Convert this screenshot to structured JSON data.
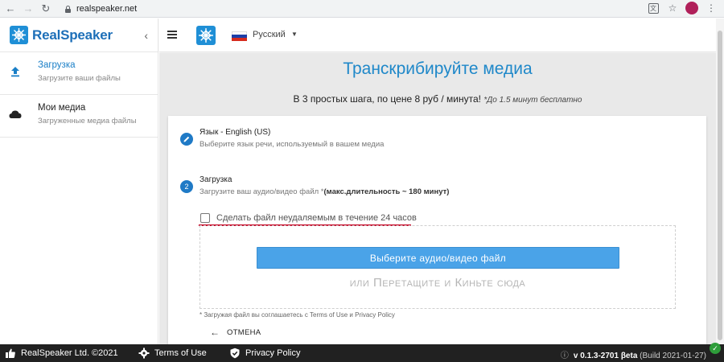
{
  "browser": {
    "url": "realspeaker.net",
    "back_icon": "back-arrow-icon",
    "forward_icon": "forward-arrow-icon",
    "reload_icon": "reload-icon"
  },
  "sidebar": {
    "brand": "RealSpeaker",
    "collapse_icon": "chevron-left-icon",
    "items": [
      {
        "title": "Загрузка",
        "subtitle": "Загрузите ваши файлы",
        "icon": "upload-icon",
        "active": true
      },
      {
        "title": "Мои медиа",
        "subtitle": "Загруженные медиа файлы",
        "icon": "cloud-icon",
        "active": false
      }
    ]
  },
  "topbar": {
    "language": "Русский",
    "flag_colors": [
      "#ffffff",
      "#1c3fa8",
      "#d52b1e"
    ]
  },
  "main": {
    "headline": "Транскрибируйте медиа",
    "subline": "В 3 простых шага, по цене 8 руб / минута!",
    "subline_note": "*До 1.5 минут бесплатно",
    "steps": [
      {
        "marker": "✎",
        "title": "Язык - English (US)",
        "subtitle": "Выберите язык речи, используемый в вашем медиа"
      },
      {
        "marker": "2",
        "title": "Загрузка",
        "subtitle": "Загрузите ваш аудио/видео файл *",
        "subtitle_bold": "(макс.длительность ~ 180 минут)"
      }
    ],
    "checkbox_label": "Сделать файл неудаляемым в течение 24 часов",
    "checkbox_checked": false,
    "select_button": "Выберите аудио/видео файл",
    "drop_hint": "или Перетащите и Киньте сюда",
    "terms_note": "* Загружая файл вы соглашаетесь с Terms of Use и Privacy Policy",
    "cancel_label": "ОТМЕНА"
  },
  "footer": {
    "company": "RealSpeaker Ltd. ©2021",
    "terms": "Terms of Use",
    "privacy": "Privacy Policy",
    "version": "v 0.1.3-2701 βeta",
    "build": "(Build 2021-01-27)"
  },
  "colors": {
    "accent": "#1f88c9",
    "button": "#4aa3e8",
    "highlight_underline": "#c8102e",
    "footer_bg": "#212121"
  }
}
